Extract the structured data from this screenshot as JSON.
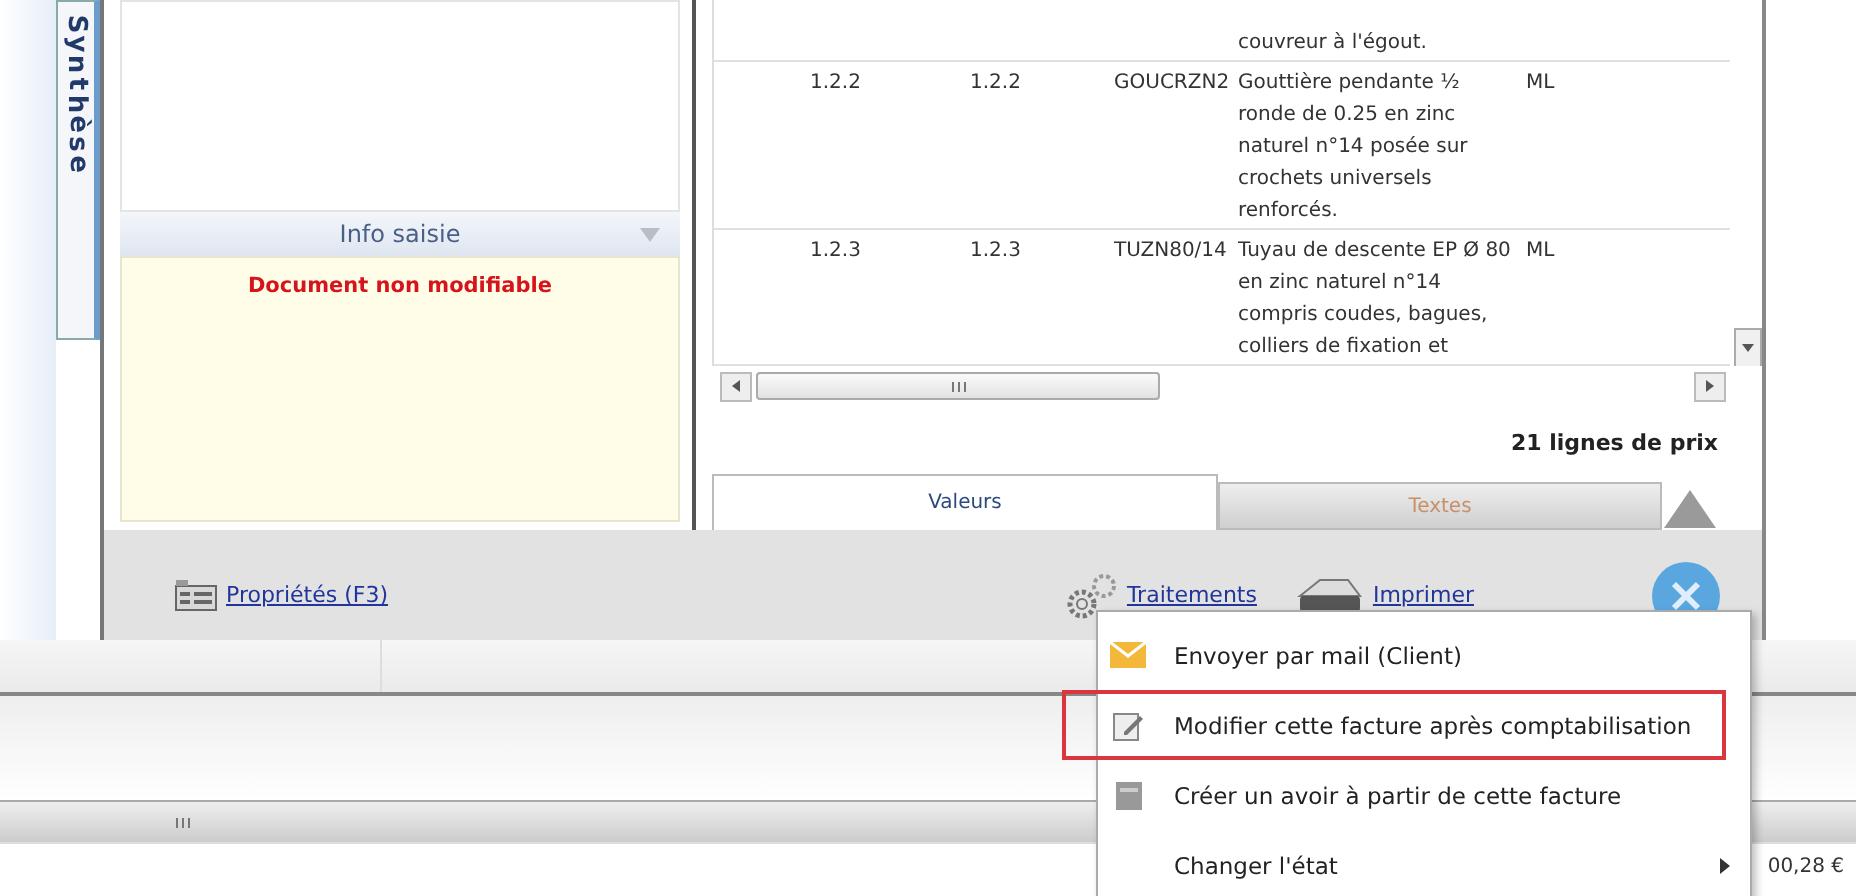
{
  "side_tab": {
    "label": "Synthèse",
    "selected": true
  },
  "info_panel": {
    "title": "Info saisie",
    "message": "Document non modifiable"
  },
  "table": {
    "partial_description": "couvreur à l'égout.",
    "rows": [
      {
        "column_1": "1.2.2",
        "column_2": "1.2.2",
        "column_3": "GOUCRZN2",
        "column_4": "Gouttière pendante ½ ronde de 0.25 en zinc naturel n°14 posée sur crochets universels renforcés.",
        "column_5": "ML"
      },
      {
        "column_1": "1.2.3",
        "column_2": "1.2.3",
        "column_3": "TUZN80/14",
        "column_4": "Tuyau de descente EP Ø 80 en zinc naturel n°14 compris coudes, bagues, colliers de fixation et",
        "column_5": "ML"
      }
    ],
    "count": "21 lignes de prix"
  },
  "tabs": [
    {
      "label": "Valeurs",
      "selected": true
    },
    {
      "label": "Textes",
      "selected": false
    }
  ],
  "toolbar": {
    "properties": "Propriétés (F3)",
    "processing": "Traitements",
    "print": "Imprimer"
  },
  "context_menu": [
    {
      "kind": "mail",
      "label": "Envoyer par mail (Client)",
      "highlighted": false,
      "submenu": false
    },
    {
      "kind": "edit",
      "label": "Modifier cette facture après comptabilisation",
      "highlighted": true,
      "submenu": false
    },
    {
      "kind": "credit",
      "label": "Créer un avoir à partir de cette facture",
      "highlighted": false,
      "submenu": false
    },
    {
      "kind": "state",
      "label": "Changer l'état",
      "highlighted": false,
      "submenu": true
    }
  ],
  "total_fragment": "00,28 €"
}
